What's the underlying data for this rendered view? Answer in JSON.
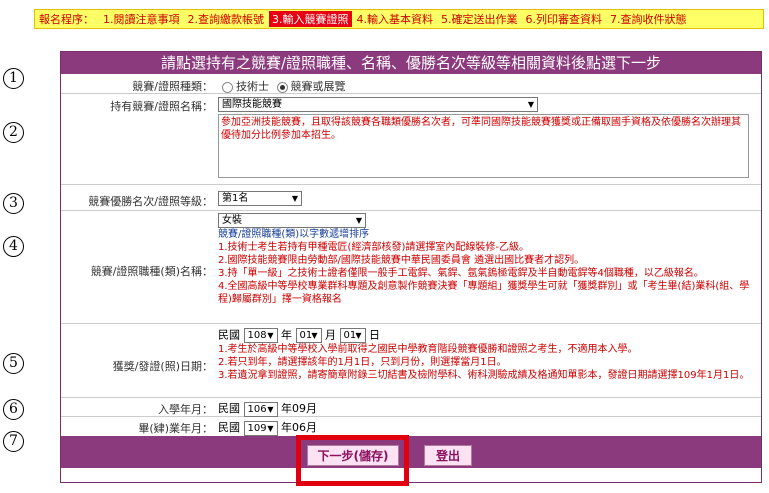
{
  "steps": {
    "lead": "報名程序：",
    "items": [
      "1.閱讀注意事項",
      "2.查詢繳款帳號",
      "3.輸入競賽證照",
      "4.輸入基本資料",
      "5.確定送出作業",
      "6.列印審查資料",
      "7.查詢收件狀態"
    ],
    "active_index": 2
  },
  "markers": [
    "1",
    "2",
    "3",
    "4",
    "5",
    "6",
    "7"
  ],
  "form": {
    "header": "請點選持有之競賽/證照職種、名稱、優勝名次等級等相關資料後點選下一步",
    "type": {
      "label": "競賽/證照種類：",
      "option1": "技術士",
      "option2": "競賽或展覽",
      "selected": "競賽或展覽"
    },
    "name": {
      "label": "持有競賽/證照名稱：",
      "select_value": "國際技能競賽",
      "note": "參加亞洲技能競賽，且取得該競賽各職類優勝名次者，可準同國際技能競賽獲獎或正備取國手資格及依優勝名次辦理其優待加分比例參加本招生。"
    },
    "rank": {
      "label": "競賽優勝名次/證照等級：",
      "select_value": "第1名"
    },
    "category": {
      "label": "競賽/證照職種(類)名稱：",
      "select_value": "女裝",
      "sort_note": "競賽/證照職種(類)以字數遞增排序",
      "notes": [
        "1.技術士考生若持有甲種電匠(經濟部核發)請選擇室內配線裝修-乙級。",
        "2.國際技能競賽限由勞動部/國際技能競賽中華民國委員會 遴選出國比賽者才認列。",
        "3.持「單一級」之技術士證者僅限一般手工電銲、氣銲、氬氣鎢極電銲及半自動電銲等4個職種，以乙級報名。",
        "4.全國高級中等學校專業群科專題及創意製作競賽決賽「專題組」獲獎學生可就「獲獎群別」或「考生畢(結)業科(組、學程)歸屬群別」擇一資格報名"
      ]
    },
    "date": {
      "label": "獲獎/發證(照)日期：",
      "era": "民國",
      "year": "108",
      "year_unit": "年",
      "month": "01",
      "month_unit": "月",
      "day": "01",
      "day_unit": "日",
      "notes": [
        "1.考生於高級中等學校入學前取得之國民中學教育階段競賽優勝和證照之考生，不適用本入學。",
        "2.若只到年，請選擇該年的1月1日，只到月份，則選擇當月1日。",
        "3.若遺況拿到證照，請寄簡章附錄三切結書及檢附學科、術科測驗成績及格通知單影本，發證日期請選擇109年1月1日。"
      ]
    },
    "enroll": {
      "label": "入學年月：",
      "era": "民國",
      "year": "106",
      "suffix": "年09月"
    },
    "graduate": {
      "label": "畢(肄)業年月：",
      "era": "民國",
      "year": "109",
      "suffix": "年06月"
    },
    "next_label": "下一步(儲存)",
    "logout_label": "登出"
  }
}
